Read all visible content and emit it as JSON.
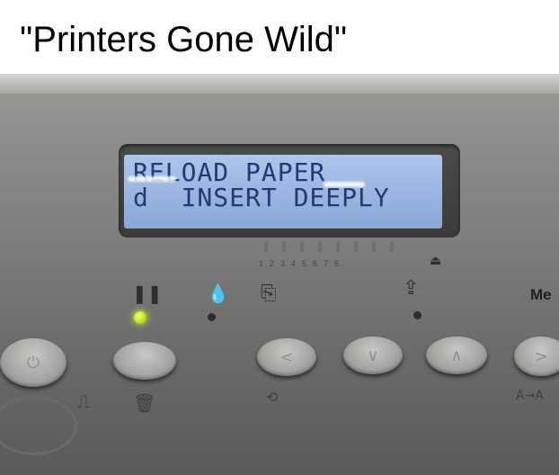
{
  "caption": "\"Printers Gone Wild\"",
  "lcd": {
    "line1": "RELOAD PAPER",
    "line2": "d  INSERT DEEPLY",
    "text_color": "#233a74",
    "backlight_color": "#9cb6e2"
  },
  "panel": {
    "ink_numbers": "12345678",
    "menu_label": "Me",
    "led_color": "#c6ee2a"
  },
  "icons": [
    "pause-icon",
    "ink-drop-icon",
    "paper-feed-icon",
    "paper-eject-icon",
    "power-icon",
    "trash-icon",
    "left-arrow-icon",
    "down-arrow-icon",
    "up-arrow-icon",
    "right-arrow-icon"
  ]
}
